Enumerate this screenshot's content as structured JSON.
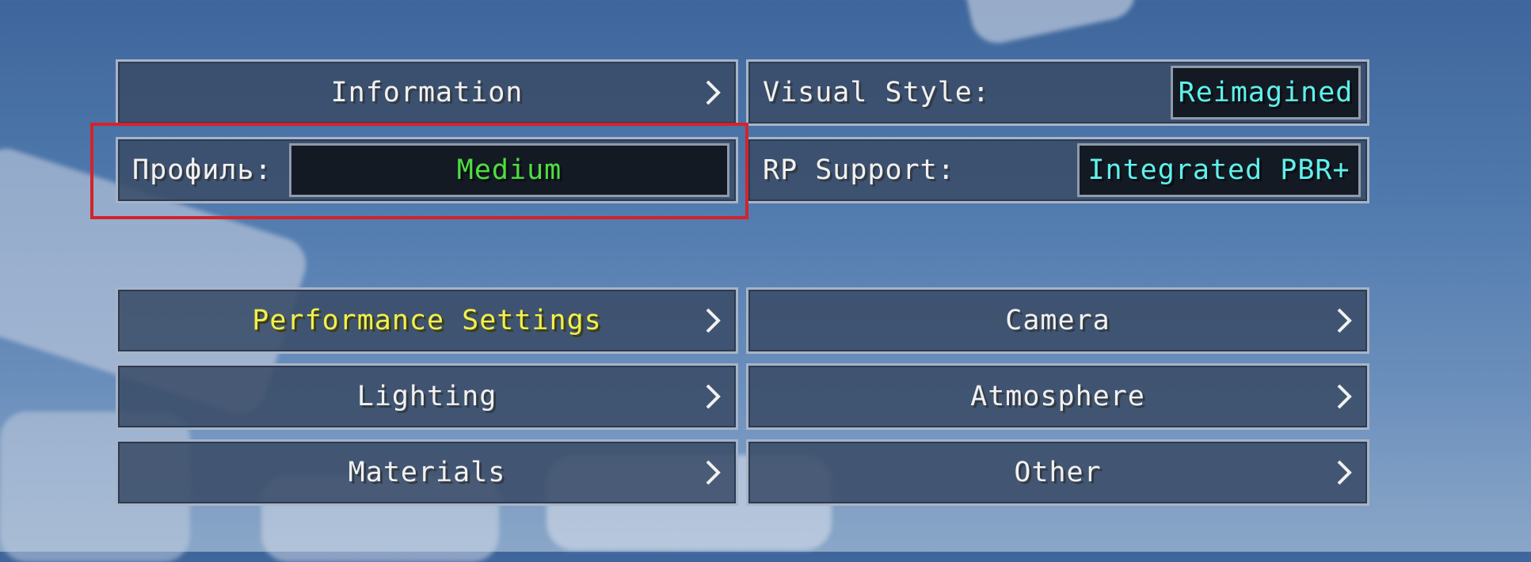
{
  "top_row": {
    "information": {
      "label": "Information"
    },
    "visual_style": {
      "label": "Visual Style:",
      "value": "Reimagined",
      "value_color": "#5ff1ec"
    }
  },
  "second_row": {
    "profile": {
      "label": "Профиль:",
      "value": "Medium",
      "value_color": "#4ddf40"
    },
    "rp_support": {
      "label": "RP Support:",
      "value": "Integrated PBR+",
      "value_color": "#5ff1ec"
    }
  },
  "menu": {
    "performance_settings": {
      "label": "Performance Settings",
      "color": "#f2f04d"
    },
    "camera": {
      "label": "Camera"
    },
    "lighting": {
      "label": "Lighting"
    },
    "atmosphere": {
      "label": "Atmosphere"
    },
    "materials": {
      "label": "Materials"
    },
    "other": {
      "label": "Other"
    }
  },
  "icons": {
    "submenu": "chevron-right-icon"
  },
  "highlight_color": "#d3232b"
}
